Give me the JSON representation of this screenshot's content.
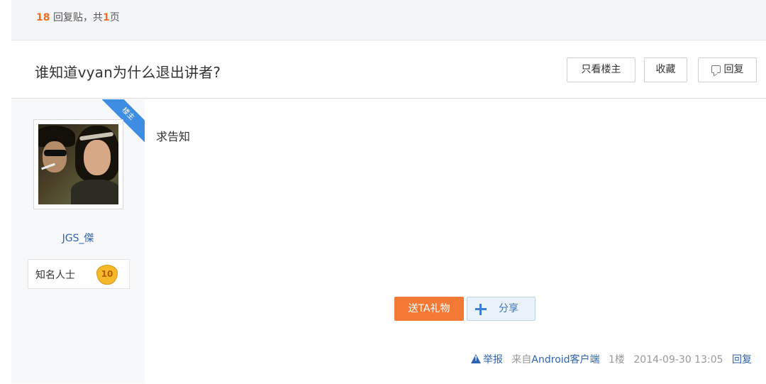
{
  "summary": {
    "reply_count": "18",
    "text_mid": "回复贴，共",
    "page_count": "1",
    "text_end": "页"
  },
  "thread": {
    "title": "谁知道vyan为什么退出讲者?"
  },
  "toolbar": {
    "only_host_label": "只看楼主",
    "favorite_label": "收藏",
    "reply_label": "回复"
  },
  "author": {
    "host_tag": "楼主",
    "name": "JGS_傑",
    "title_label": "知名人士",
    "level": "10"
  },
  "post": {
    "content": "求告知",
    "gift_label": "送TA礼物",
    "share_label": "分享"
  },
  "footer": {
    "report_label": "举报",
    "source_prefix": "来自",
    "source_link": "Android客户端",
    "floor": "1楼",
    "datetime": "2014-09-30 13:05",
    "reply_label": "回复"
  },
  "colors": {
    "accent_orange": "#f37935",
    "link_blue": "#2d64b3",
    "ribbon_blue": "#3d8de2"
  }
}
